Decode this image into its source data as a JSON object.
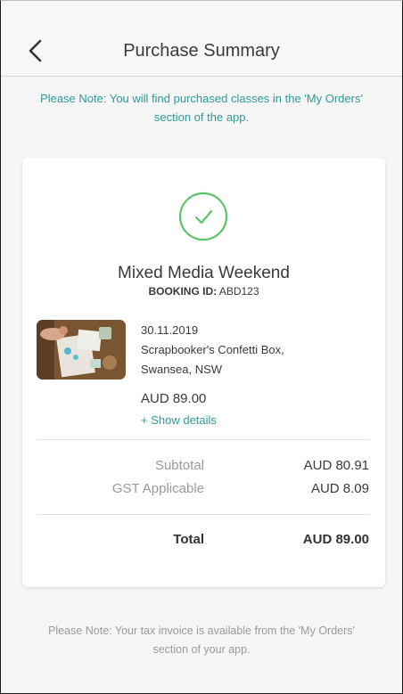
{
  "header": {
    "title": "Purchase Summary"
  },
  "notes": {
    "top": "Please Note: You will find purchased classes in the 'My Orders' section of the app.",
    "bottom": "Please Note: Your tax invoice is available from the 'My Orders' section of your app."
  },
  "booking": {
    "event_name": "Mixed Media Weekend",
    "id_label": "BOOKING ID:",
    "id_value": "ABD123",
    "date": "30.11.2019",
    "venue_line1": "Scrapbooker's Confetti Box,",
    "venue_line2": "Swansea, NSW",
    "price": "AUD 89.00",
    "show_details": "+ Show details"
  },
  "summary": {
    "subtotal_label": "Subtotal",
    "subtotal_value": "AUD 80.91",
    "gst_label": "GST Applicable",
    "gst_value": "AUD 8.09",
    "total_label": "Total",
    "total_value": "AUD 89.00"
  },
  "colors": {
    "accent_teal": "#2f9a9a",
    "success_green": "#5cc36b"
  }
}
